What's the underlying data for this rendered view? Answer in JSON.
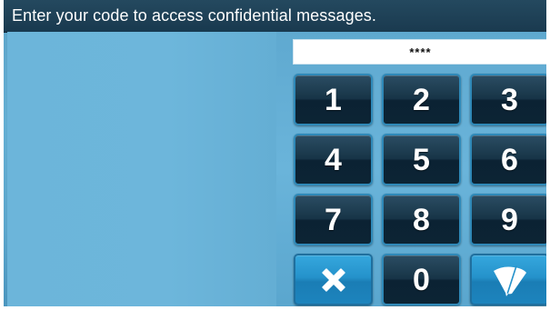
{
  "header": {
    "title": "Enter your code to access confidential messages."
  },
  "code_entry": {
    "masked_value": "****"
  },
  "keypad": {
    "keys": [
      {
        "label": "1"
      },
      {
        "label": "2"
      },
      {
        "label": "3"
      },
      {
        "label": "4"
      },
      {
        "label": "5"
      },
      {
        "label": "6"
      },
      {
        "label": "7"
      },
      {
        "label": "8"
      },
      {
        "label": "9"
      },
      {
        "label": "0"
      }
    ],
    "clear_icon": "close-icon",
    "erase_icon": "eraser-icon"
  },
  "colors": {
    "title_bar": "#1f4257",
    "background": "#67b2d6",
    "key_dark": "#0b2233",
    "key_action": "#2592cb"
  }
}
